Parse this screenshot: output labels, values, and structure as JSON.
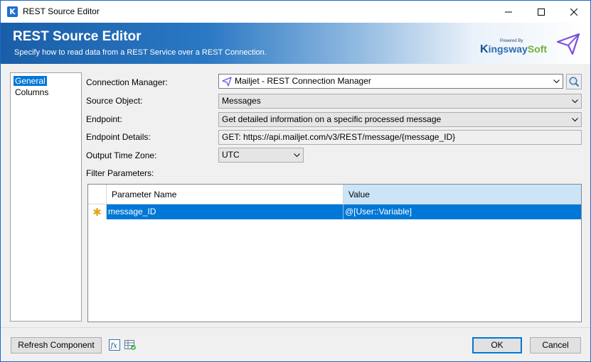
{
  "window": {
    "title": "REST Source Editor",
    "app_icon_glyph": "K"
  },
  "banner": {
    "title": "REST Source Editor",
    "subtitle": "Specify how to read data from a REST Service over a REST Connection.",
    "brand_powered": "Powered By",
    "brand_k": "K",
    "brand_ingsway": "ingsway",
    "brand_soft": "Soft"
  },
  "nav": {
    "items": [
      {
        "label": "General",
        "selected": true
      },
      {
        "label": "Columns",
        "selected": false
      }
    ]
  },
  "form": {
    "connection_manager": {
      "label": "Connection Manager:",
      "value": "Mailjet - REST Connection Manager"
    },
    "source_object": {
      "label": "Source Object:",
      "value": "Messages"
    },
    "endpoint": {
      "label": "Endpoint:",
      "value": "Get detailed information on a specific processed message"
    },
    "endpoint_details": {
      "label": "Endpoint Details:",
      "value": "GET: https://api.mailjet.com/v3/REST/message/{message_ID}"
    },
    "output_time_zone": {
      "label": "Output Time Zone:",
      "value": "UTC"
    },
    "filter_parameters": {
      "label": "Filter Parameters:"
    }
  },
  "grid": {
    "columns": [
      "Parameter Name",
      "Value"
    ],
    "rows": [
      {
        "marker": "✱",
        "name": "message_ID",
        "value": "@[User::Variable]"
      }
    ]
  },
  "footer": {
    "refresh_label": "Refresh Component",
    "ok_label": "OK",
    "cancel_label": "Cancel"
  },
  "colors": {
    "accent": "#0078d7",
    "banner_dark": "#1a5ea8",
    "brand_green": "#6fb03a",
    "plane_purple": "#7b4ee0"
  }
}
